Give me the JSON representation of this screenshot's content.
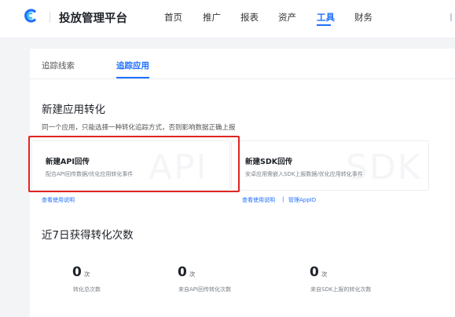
{
  "header": {
    "app_title": "投放管理平台",
    "nav": [
      {
        "label": "首页"
      },
      {
        "label": "推广"
      },
      {
        "label": "报表"
      },
      {
        "label": "资产"
      },
      {
        "label": "工具",
        "active": true
      },
      {
        "label": "财务"
      }
    ],
    "accent_color": "#1f6fff"
  },
  "tabs": [
    {
      "label": "追踪线索"
    },
    {
      "label": "追踪应用",
      "active": true
    }
  ],
  "section_new": {
    "title": "新建应用转化",
    "description": "同一个应用，只能选择一种转化追踪方式，否则影响数据正确上报"
  },
  "cards": [
    {
      "title": "新建API回传",
      "description": "配合API回传数据/优化应用转化事件",
      "watermark": "API",
      "highlighted": true,
      "highlight_color": "#e02424"
    },
    {
      "title": "新建SDK回传",
      "description": "安卓应用需嵌入SDK上报数据/优化应用转化事件",
      "watermark": "SDK"
    }
  ],
  "links": {
    "api_help": "查看使用说明",
    "sdk_help": "查看使用说明",
    "separator": "|",
    "manage_appid": "管理AppID"
  },
  "section_stats": {
    "title": "近7日获得转化次数",
    "stats": [
      {
        "value": "0",
        "unit": "次",
        "label": "转化总次数"
      },
      {
        "value": "0",
        "unit": "次",
        "label": "来自API回传转化次数"
      },
      {
        "value": "0",
        "unit": "次",
        "label": "来自SDK上报的转化次数"
      }
    ]
  }
}
